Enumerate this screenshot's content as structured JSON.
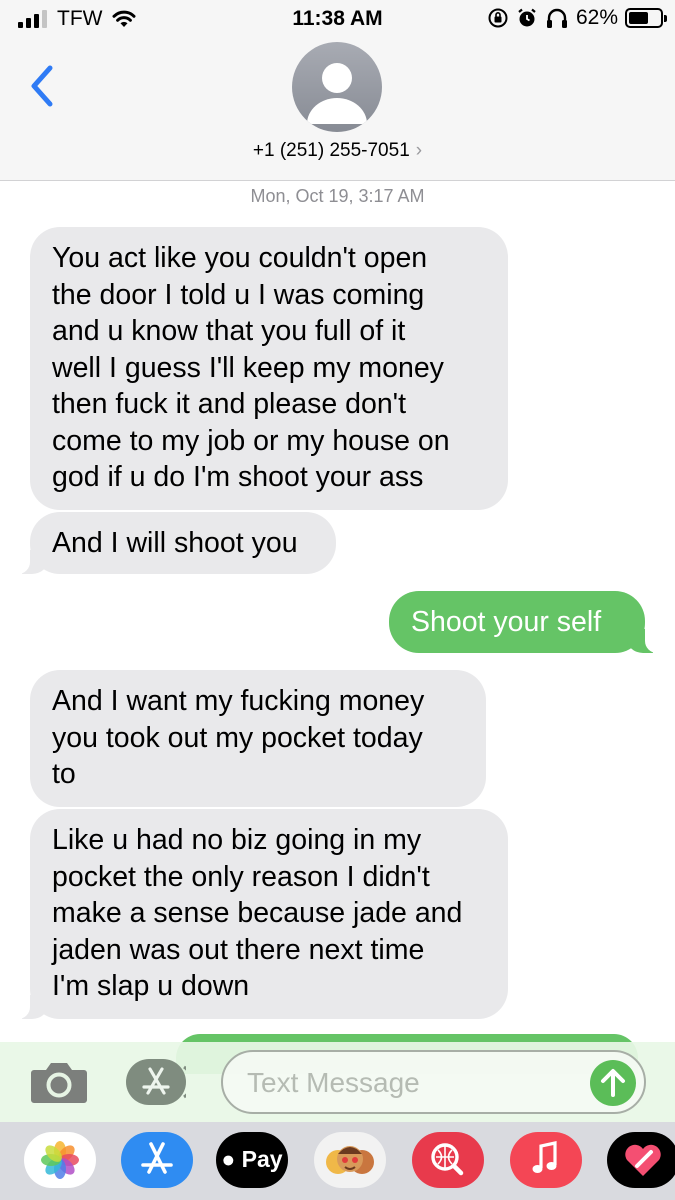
{
  "status_bar": {
    "carrier": "TFW",
    "time": "11:38 AM",
    "battery_percent": "62%",
    "battery_level": 0.62
  },
  "header": {
    "contact": "+1 (251) 255-7051",
    "chevron": "›"
  },
  "thread": {
    "timestamp": "Mon, Oct 19, 3:17 AM",
    "messages": [
      {
        "direction": "incoming",
        "text": "You act like you couldn't open\nthe door I told u I was coming\nand u know that you full of it\nwell I guess I'll keep my money\nthen fuck it and please don't\ncome to my job or my house on\ngod if u do I'm shoot your ass"
      },
      {
        "direction": "incoming",
        "text": "And I will shoot you"
      },
      {
        "direction": "outgoing",
        "text": "Shoot your self"
      },
      {
        "direction": "incoming",
        "text": "And I want my fucking money\nyou took out my pocket today\nto"
      },
      {
        "direction": "incoming",
        "text": "Like u had no biz going in my\npocket the only reason I didn't\nmake a sense because jade and\njaden was out there next time\nI'm slap u down"
      }
    ]
  },
  "input": {
    "placeholder": "Text Message"
  },
  "drawer": {
    "apps": [
      {
        "icon": "photos-icon"
      },
      {
        "icon": "app-store-icon"
      },
      {
        "icon": "apple-pay-icon",
        "label": "Pay"
      },
      {
        "icon": "memoji-icon"
      },
      {
        "icon": "web-search-icon"
      },
      {
        "icon": "music-icon"
      },
      {
        "icon": "digital-touch-icon"
      }
    ]
  },
  "colors": {
    "incoming_bubble": "#e9e9eb",
    "outgoing_bubble": "#65c466",
    "accent_blue": "#2f7bf5",
    "timestamp_gray": "#8e8e93"
  }
}
